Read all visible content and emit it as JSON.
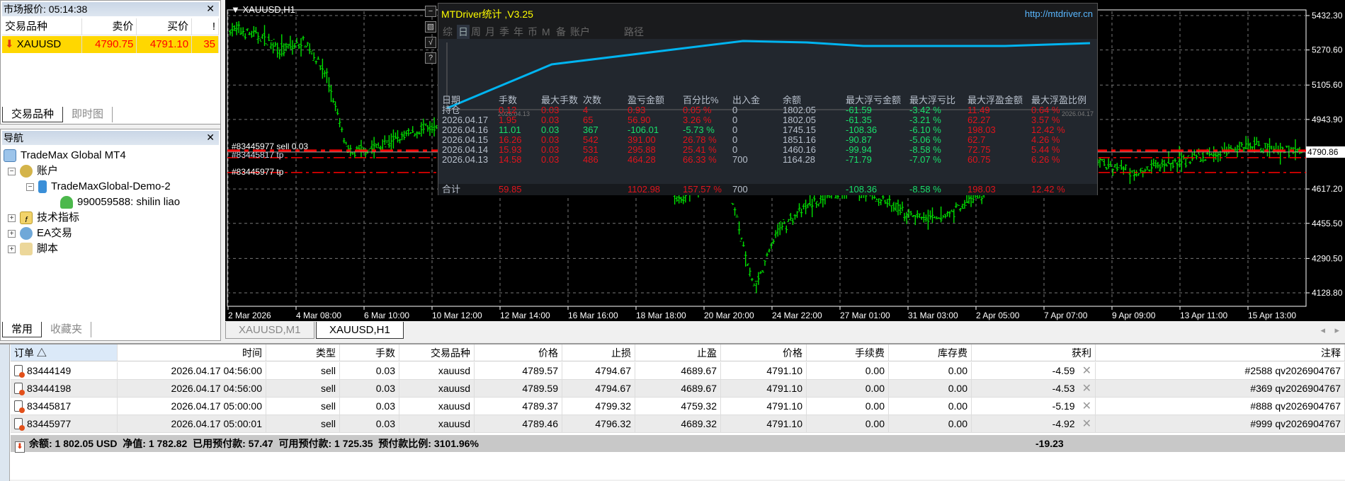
{
  "market_watch": {
    "title": "市场报价: 05:14:38",
    "columns": [
      "交易品种",
      "卖价",
      "买价",
      "!"
    ],
    "rows": [
      {
        "symbol": "XAUUSD",
        "bid": "4790.75",
        "ask": "4791.10",
        "spread": "35",
        "direction": "down"
      }
    ],
    "tabs": [
      "交易品种",
      "即时图"
    ],
    "highlight_color": "#ffd700"
  },
  "navigator": {
    "title": "导航",
    "root": "TradeMax Global MT4",
    "accounts": "账户",
    "server": "TradeMaxGlobal-Demo-2",
    "account": "990059588: shilin liao",
    "indicators": "技术指标",
    "experts": "EA交易",
    "scripts": "脚本",
    "tabs": [
      "常用",
      "收藏夹"
    ]
  },
  "chart": {
    "title": "XAUUSD,H1",
    "price_ticks": [
      "5432.30",
      "5270.60",
      "5105.60",
      "4943.90",
      "4617.20",
      "4455.50",
      "4290.50",
      "4128.80"
    ],
    "current_price": "4790.86",
    "time_ticks": [
      "2 Mar 2026",
      "4 Mar 08:00",
      "6 Mar 10:00",
      "10 Mar 12:00",
      "12 Mar 14:00",
      "16 Mar 16:00",
      "18 Mar 18:00",
      "20 Mar 20:00",
      "24 Mar 22:00",
      "27 Mar 01:00",
      "31 Mar 03:00",
      "2 Apr 05:00",
      "7 Apr 07:00",
      "9 Apr 09:00",
      "13 Apr 11:00",
      "15 Apr 13:00"
    ],
    "order_labels": {
      "sell": "#83445977 sell 0.03",
      "tp1": "#83445817 tp",
      "tp2": "#83445977 tp"
    },
    "bar_color": "#00e000",
    "order_line_color": "#ff0000",
    "side_buttons": [
      "−",
      "▧",
      "√",
      "?"
    ]
  },
  "mtdriver": {
    "title": "MTDriver统计 ,V3.25",
    "url": "http://mtdriver.cn",
    "tabs": [
      "综",
      "日",
      "周",
      "月",
      "季",
      "年",
      "币",
      "M",
      "备",
      "账户",
      "路径"
    ],
    "active_tab": "日",
    "equity_start_label": "2026.04.13",
    "equity_end_label": "2026.04.17",
    "line_color": "#00b4f0",
    "columns": [
      "日期",
      "手数",
      "最大手数",
      "次数",
      "盈亏金额",
      "百分比%",
      "出入金",
      "余额",
      "最大浮亏金额",
      "最大浮亏比",
      "最大浮盈金额",
      "最大浮盈比例"
    ],
    "rows": [
      {
        "date": "持仓",
        "lots": "0.12",
        "max_lots": "0.03",
        "count": "4",
        "pl": "0.93",
        "pct": "0.05 %",
        "dep": "0",
        "bal": "1802.05",
        "mfl": "-61.59",
        "mflp": "-3.42 %",
        "mfp": "11.49",
        "mfpp": "0.64 %",
        "tone": "red"
      },
      {
        "date": "2026.04.17",
        "lots": "1.95",
        "max_lots": "0.03",
        "count": "65",
        "pl": "56.90",
        "pct": "3.26 %",
        "dep": "0",
        "bal": "1802.05",
        "mfl": "-61.35",
        "mflp": "-3.21 %",
        "mfp": "62.27",
        "mfpp": "3.57 %",
        "tone": "red"
      },
      {
        "date": "2026.04.16",
        "lots": "11.01",
        "max_lots": "0.03",
        "count": "367",
        "pl": "-106.01",
        "pct": "-5.73 %",
        "dep": "0",
        "bal": "1745.15",
        "mfl": "-108.36",
        "mflp": "-6.10 %",
        "mfp": "198.03",
        "mfpp": "12.42 %",
        "tone": "grn"
      },
      {
        "date": "2026.04.15",
        "lots": "16.26",
        "max_lots": "0.03",
        "count": "542",
        "pl": "391.00",
        "pct": "26.78 %",
        "dep": "0",
        "bal": "1851.16",
        "mfl": "-90.87",
        "mflp": "-5.06 %",
        "mfp": "62.7",
        "mfpp": "4.26 %",
        "tone": "red"
      },
      {
        "date": "2026.04.14",
        "lots": "15.93",
        "max_lots": "0.03",
        "count": "531",
        "pl": "295.88",
        "pct": "25.41 %",
        "dep": "0",
        "bal": "1460.16",
        "mfl": "-99.94",
        "mflp": "-8.58 %",
        "mfp": "72.75",
        "mfpp": "5.44 %",
        "tone": "red"
      },
      {
        "date": "2026.04.13",
        "lots": "14.58",
        "max_lots": "0.03",
        "count": "486",
        "pl": "464.28",
        "pct": "66.33 %",
        "dep": "700",
        "bal": "1164.28",
        "mfl": "-71.79",
        "mflp": "-7.07 %",
        "mfp": "60.75",
        "mfpp": "6.26 %",
        "tone": "red"
      }
    ],
    "total": {
      "date": "合计",
      "lots": "59.85",
      "pl": "1102.98",
      "pct": "157.57 %",
      "dep": "700",
      "mfl": "-108.36",
      "mflp": "-8.58 %",
      "mfp": "198.03",
      "mfpp": "12.42 %"
    }
  },
  "chart_tabs": [
    "XAUUSD,M1",
    "XAUUSD,H1"
  ],
  "active_chart_tab": "XAUUSD,H1",
  "terminal": {
    "columns": [
      "订单 △",
      "时间",
      "类型",
      "手数",
      "交易品种",
      "价格",
      "止损",
      "止盈",
      "价格",
      "手续费",
      "库存费",
      "获利",
      "注释"
    ],
    "orders": [
      [
        "83444149",
        "2026.04.17 04:56:00",
        "sell",
        "0.03",
        "xauusd",
        "4789.57",
        "4794.67",
        "4689.67",
        "4791.10",
        "0.00",
        "0.00",
        "-4.59",
        "#2588 qv2026904767"
      ],
      [
        "83444198",
        "2026.04.17 04:56:00",
        "sell",
        "0.03",
        "xauusd",
        "4789.59",
        "4794.67",
        "4689.67",
        "4791.10",
        "0.00",
        "0.00",
        "-4.53",
        "#369 qv2026904767"
      ],
      [
        "83445817",
        "2026.04.17 05:00:00",
        "sell",
        "0.03",
        "xauusd",
        "4789.37",
        "4799.32",
        "4759.32",
        "4791.10",
        "0.00",
        "0.00",
        "-5.19",
        "#888 qv2026904767"
      ],
      [
        "83445977",
        "2026.04.17 05:00:01",
        "sell",
        "0.03",
        "xauusd",
        "4789.46",
        "4796.32",
        "4689.32",
        "4791.10",
        "0.00",
        "0.00",
        "-4.92",
        "#999 qv2026904767"
      ]
    ],
    "summary": "余额: 1 802.05 USD  净值: 1 782.82  已用预付款: 57.47  可用预付款: 1 725.35  预付款比例: 3101.96%",
    "total_profit": "-19.23"
  }
}
